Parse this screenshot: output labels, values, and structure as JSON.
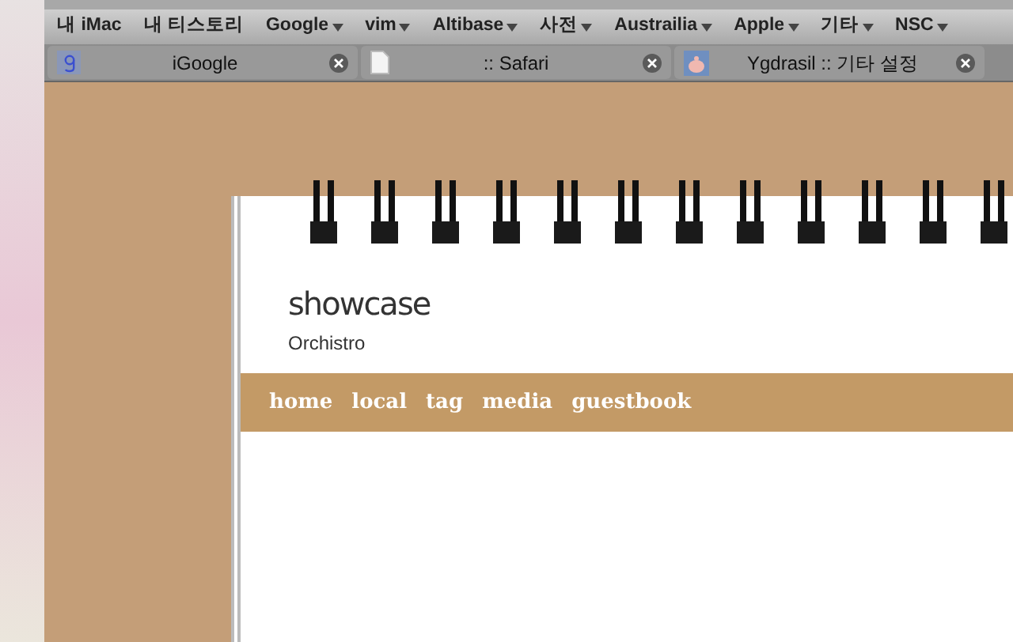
{
  "bookmarks": [
    {
      "label": "내 iMac",
      "dropdown": false
    },
    {
      "label": "내 티스토리",
      "dropdown": false
    },
    {
      "label": "Google",
      "dropdown": true
    },
    {
      "label": "vim",
      "dropdown": true
    },
    {
      "label": "Altibase",
      "dropdown": true
    },
    {
      "label": "사전",
      "dropdown": true
    },
    {
      "label": "Austrailia",
      "dropdown": true
    },
    {
      "label": "Apple",
      "dropdown": true
    },
    {
      "label": "기타",
      "dropdown": true
    },
    {
      "label": "NSC",
      "dropdown": true
    }
  ],
  "tabs": [
    {
      "title": "iGoogle",
      "kind": "google",
      "selected": false
    },
    {
      "title": ":: Safari",
      "kind": "page",
      "selected": false
    },
    {
      "title": "Ygdrasil :: 기타 설정",
      "kind": "avatar",
      "selected": false
    }
  ],
  "blog": {
    "title": "showcase",
    "subtitle": "Orchistro",
    "nav": [
      "home",
      "local",
      "tag",
      "media",
      "guestbook"
    ]
  }
}
